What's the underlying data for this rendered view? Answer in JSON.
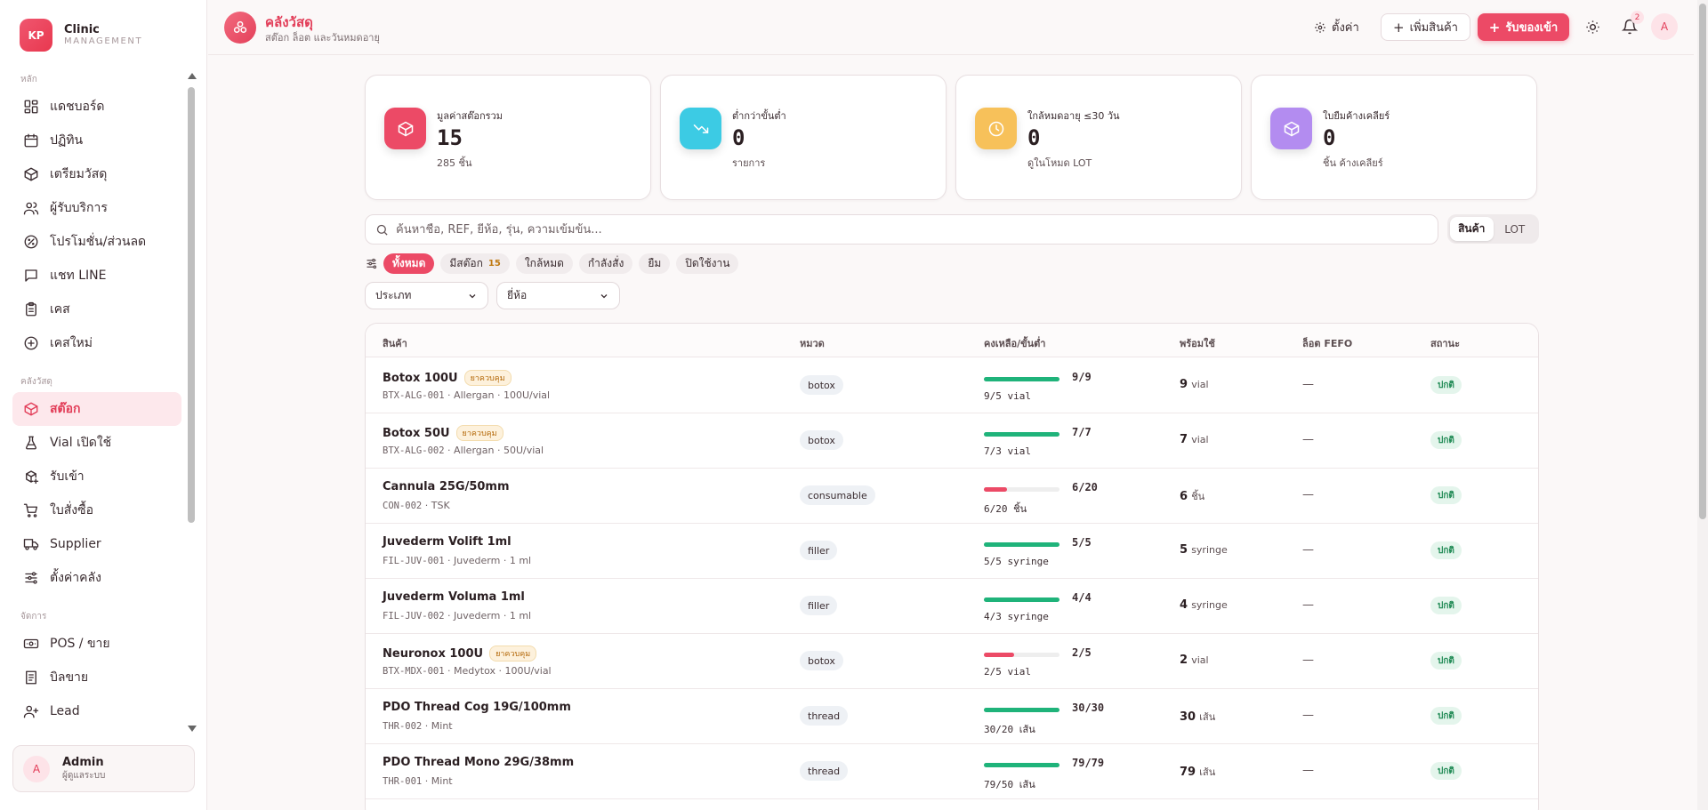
{
  "brand": {
    "initials": "KP",
    "name": "Clinic",
    "sub": "MANAGEMENT"
  },
  "sidebar": {
    "sections": [
      {
        "title": "หลัก",
        "items": [
          {
            "key": "dashboard",
            "label": "แดชบอร์ด",
            "icon": "grid-icon"
          },
          {
            "key": "calendar",
            "label": "ปฏิทิน",
            "icon": "calendar-icon"
          },
          {
            "key": "prep",
            "label": "เตรียมวัสดุ",
            "icon": "package-icon"
          },
          {
            "key": "clients",
            "label": "ผู้รับบริการ",
            "icon": "users-icon"
          },
          {
            "key": "promo",
            "label": "โปรโมชั่น/ส่วนลด",
            "icon": "discount-icon"
          },
          {
            "key": "line",
            "label": "แชท LINE",
            "icon": "chat-icon"
          },
          {
            "key": "cases",
            "label": "เคส",
            "icon": "clipboard-icon"
          },
          {
            "key": "newcase",
            "label": "เคสใหม่",
            "icon": "plus-circle-icon"
          }
        ]
      },
      {
        "title": "คลังวัสดุ",
        "items": [
          {
            "key": "stock",
            "label": "สต๊อก",
            "icon": "package-icon",
            "active": true
          },
          {
            "key": "vial",
            "label": "Vial เปิดใช้",
            "icon": "flask-icon"
          },
          {
            "key": "receive",
            "label": "รับเข้า",
            "icon": "package-plus-icon"
          },
          {
            "key": "po",
            "label": "ใบสั่งซื้อ",
            "icon": "cart-icon"
          },
          {
            "key": "supplier",
            "label": "Supplier",
            "icon": "truck-icon"
          },
          {
            "key": "inv-settings",
            "label": "ตั้งค่าคลัง",
            "icon": "sliders-icon"
          }
        ]
      },
      {
        "title": "จัดการ",
        "items": [
          {
            "key": "pos",
            "label": "POS / ขาย",
            "icon": "pos-icon"
          },
          {
            "key": "bills",
            "label": "บิลขาย",
            "icon": "receipt-icon"
          },
          {
            "key": "lead",
            "label": "Lead",
            "icon": "user-plus-icon"
          }
        ]
      }
    ]
  },
  "user": {
    "initial": "A",
    "name": "Admin",
    "role": "ผู้ดูแลระบบ"
  },
  "header": {
    "title": "คลังวัสดุ",
    "subtitle": "สต๊อก ล็อต และวันหมดอายุ",
    "settings_label": "ตั้งค่า",
    "add_label": "เพิ่มสินค้า",
    "receive_label": "รับของเข้า",
    "bell_count": "2",
    "avatar_initial": "A"
  },
  "stats": [
    {
      "label": "มูลค่าสต๊อกรวม",
      "value": "15",
      "sub": "285 ชิ้น",
      "color": "#ec4a66",
      "icon": "package-icon"
    },
    {
      "label": "ต่ำกว่าขั้นต่ำ",
      "value": "0",
      "sub": "รายการ",
      "color": "#3ccbe4",
      "icon": "trending-down-icon"
    },
    {
      "label": "ใกล้หมดอายุ ≤30 วัน",
      "value": "0",
      "sub": "ดูในโหมด LOT",
      "color": "#f7c15a",
      "icon": "clock-icon"
    },
    {
      "label": "ใบยืมค้างเคลียร์",
      "value": "0",
      "sub": "ชิ้น ค้างเคลียร์",
      "color": "#b38cf0",
      "icon": "package-icon"
    }
  ],
  "search": {
    "placeholder": "ค้นหาชื่อ, REF, ยี่ห้อ, รุ่น, ความเข้มข้น..."
  },
  "view_toggle": {
    "product": "สินค้า",
    "lot": "LOT"
  },
  "filters": [
    {
      "label": "ทั้งหมด",
      "active": true
    },
    {
      "label": "มีสต๊อก",
      "count": "15"
    },
    {
      "label": "ใกล้หมด"
    },
    {
      "label": "กำลังสั่ง"
    },
    {
      "label": "ยืม"
    },
    {
      "label": "ปิดใช้งาน"
    }
  ],
  "selects": {
    "type": "ประเภท",
    "brand": "ยี่ห้อ"
  },
  "table": {
    "headers": {
      "product": "สินค้า",
      "category": "หมวด",
      "remaining": "คงเหลือ/ขั้นต่ำ",
      "ready": "พร้อมใช้",
      "fefo": "ล็อต FEFO",
      "status": "สถานะ"
    },
    "rows": [
      {
        "name": "Botox 100U",
        "controlled": "ยาควบคุม",
        "code": "BTX-ALG-001",
        "meta": "Allergan · 100U/vial",
        "category": "botox",
        "ratio": "9/9",
        "fill": 1.0,
        "bar_color": "#1fb37a",
        "sub": "9/5 vial",
        "ready": "9",
        "unit": "vial",
        "fefo": "—",
        "status": "ปกติ"
      },
      {
        "name": "Botox 50U",
        "controlled": "ยาควบคุม",
        "code": "BTX-ALG-002",
        "meta": "Allergan · 50U/vial",
        "category": "botox",
        "ratio": "7/7",
        "fill": 1.0,
        "bar_color": "#1fb37a",
        "sub": "7/3 vial",
        "ready": "7",
        "unit": "vial",
        "fefo": "—",
        "status": "ปกติ"
      },
      {
        "name": "Cannula 25G/50mm",
        "controlled": "",
        "code": "CON-002",
        "meta": "TSK",
        "category": "consumable",
        "ratio": "6/20",
        "fill": 0.3,
        "bar_color": "#ec4a66",
        "sub": "6/20 ชิ้น",
        "ready": "6",
        "unit": "ชิ้น",
        "fefo": "—",
        "status": "ปกติ"
      },
      {
        "name": "Juvederm Volift 1ml",
        "controlled": "",
        "code": "FIL-JUV-001",
        "meta": "Juvederm · 1 ml",
        "category": "filler",
        "ratio": "5/5",
        "fill": 1.0,
        "bar_color": "#1fb37a",
        "sub": "5/5 syringe",
        "ready": "5",
        "unit": "syringe",
        "fefo": "—",
        "status": "ปกติ"
      },
      {
        "name": "Juvederm Voluma 1ml",
        "controlled": "",
        "code": "FIL-JUV-002",
        "meta": "Juvederm · 1 ml",
        "category": "filler",
        "ratio": "4/4",
        "fill": 1.0,
        "bar_color": "#1fb37a",
        "sub": "4/3 syringe",
        "ready": "4",
        "unit": "syringe",
        "fefo": "—",
        "status": "ปกติ"
      },
      {
        "name": "Neuronox 100U",
        "controlled": "ยาควบคุม",
        "code": "BTX-MDX-001",
        "meta": "Medytox · 100U/vial",
        "category": "botox",
        "ratio": "2/5",
        "fill": 0.4,
        "bar_color": "#ec4a66",
        "sub": "2/5 vial",
        "ready": "2",
        "unit": "vial",
        "fefo": "—",
        "status": "ปกติ"
      },
      {
        "name": "PDO Thread Cog 19G/100mm",
        "controlled": "",
        "code": "THR-002",
        "meta": "Mint",
        "category": "thread",
        "ratio": "30/30",
        "fill": 1.0,
        "bar_color": "#1fb37a",
        "sub": "30/20 เส้น",
        "ready": "30",
        "unit": "เส้น",
        "fefo": "—",
        "status": "ปกติ"
      },
      {
        "name": "PDO Thread Mono 29G/38mm",
        "controlled": "",
        "code": "THR-001",
        "meta": "Mint",
        "category": "thread",
        "ratio": "79/79",
        "fill": 1.0,
        "bar_color": "#1fb37a",
        "sub": "79/50 เส้น",
        "ready": "79",
        "unit": "เส้น",
        "fefo": "—",
        "status": "ปกติ"
      }
    ]
  }
}
